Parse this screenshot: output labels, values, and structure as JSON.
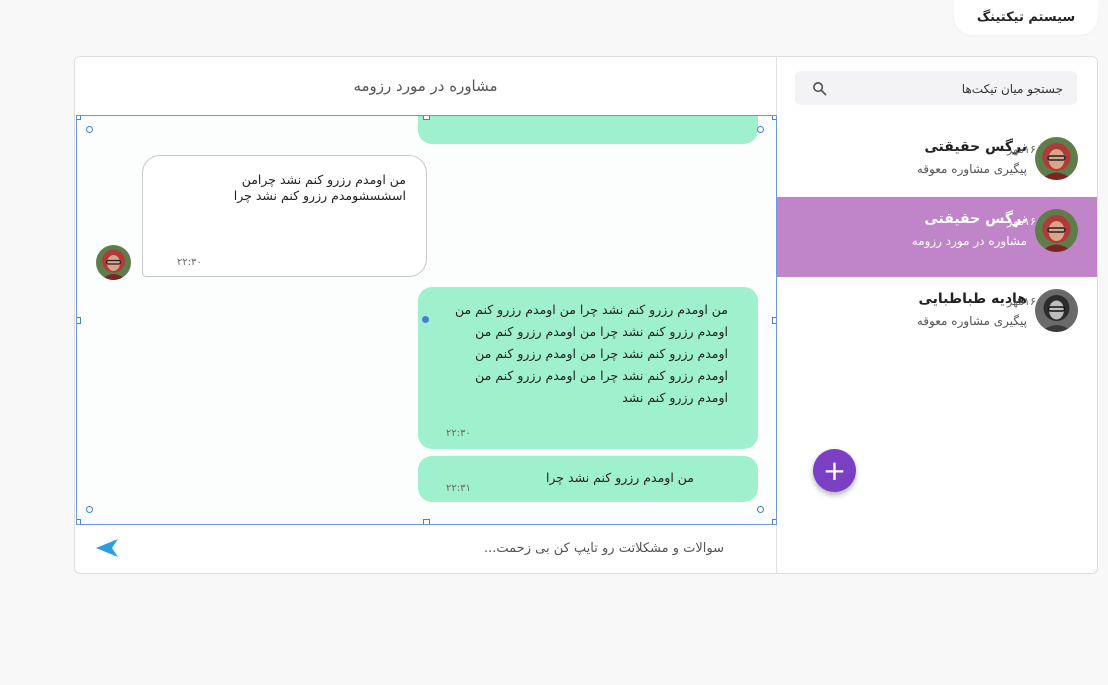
{
  "header": {
    "system_title": "سیستم تیکتینگ"
  },
  "search": {
    "placeholder": "جستجو میان تیکت‌ها"
  },
  "tickets": [
    {
      "name": "نرگس حقیقتی",
      "subject": "پیگیری مشاوره معوقه",
      "date": "۱۶مهر",
      "active": false
    },
    {
      "name": "نرگس حقیقتی",
      "subject": "مشاوره در مورد رزومه",
      "date": "۱۶مهر",
      "active": true
    },
    {
      "name": "هادیه طباطبایی",
      "subject": "پیگیری مشاوره معوقه",
      "date": "۱۶مهر",
      "active": false
    }
  ],
  "chat": {
    "title": "مشاوره در مورد رزومه",
    "messages": [
      {
        "direction": "in",
        "text": "من اومدم رزرو کنم نشد چرامن اسشسشومدم رزرو کنم نشد چرا",
        "time": "۲۲:۳۰"
      },
      {
        "direction": "out",
        "text": "من اومدم رزرو کنم نشد چرا من اومدم رزرو کنم من اومدم رزرو کنم نشد چرا من اومدم رزرو کنم من اومدم رزرو کنم نشد چرا من اومدم رزرو کنم من اومدم رزرو کنم نشد چرا من اومدم رزرو کنم من اومدم رزرو کنم نشد",
        "time": "۲۲:۳۰"
      },
      {
        "direction": "out",
        "text": "من اومدم رزرو کنم نشد چرا",
        "time": "۲۲:۳۱"
      }
    ],
    "composer_placeholder": "سوالات و مشکلاتت رو تایپ کن بی زحمت..."
  },
  "colors": {
    "active_ticket": "#c084c9",
    "outgoing_bubble": "#9ff0cc",
    "fab": "#7b3fc4",
    "send_icon": "#2b9fe0",
    "selection": "#4a7fd0"
  },
  "icons": {
    "search": "search-icon",
    "add": "plus-icon",
    "send": "send-icon"
  },
  "fab": {
    "label": "+"
  }
}
